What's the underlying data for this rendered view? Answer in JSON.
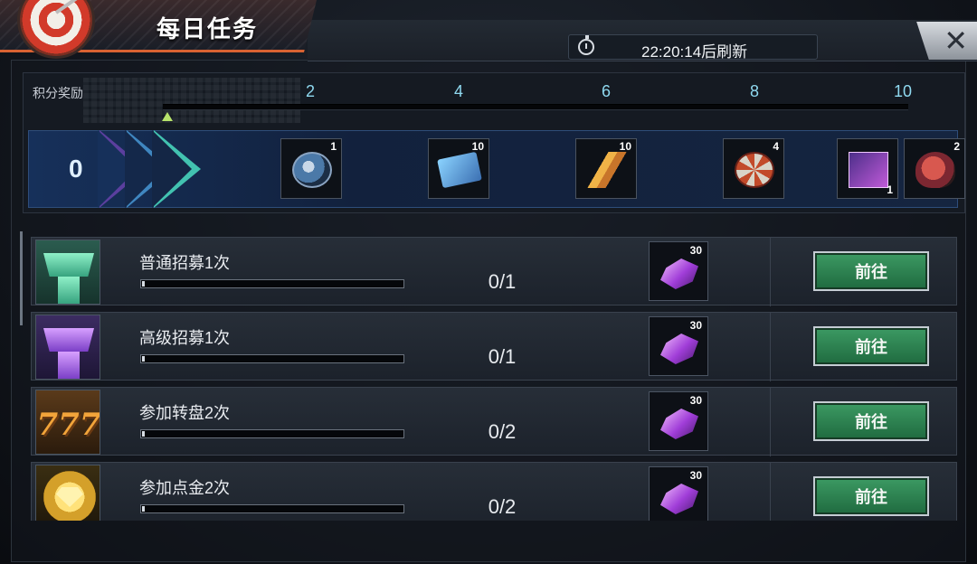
{
  "header": {
    "title": "每日任务",
    "refresh": "22:20:14后刷新",
    "close": "✕"
  },
  "reward": {
    "label": "积分奖励",
    "points": "0",
    "milestones": [
      "2",
      "4",
      "6",
      "8",
      "10"
    ],
    "items": [
      {
        "icon": "coin-icon",
        "count": "1"
      },
      {
        "icon": "ticket-icon",
        "count": "10"
      },
      {
        "icon": "bullet-icon",
        "count": "10"
      },
      {
        "icon": "chip-icon",
        "count": "4"
      },
      {
        "icon": "card-icon",
        "count": "1"
      },
      {
        "icon": "rations-icon",
        "count": "2"
      }
    ]
  },
  "tasks": [
    {
      "name": "普通招募1次",
      "progress": "0/1",
      "fraction": 0,
      "reward": "30",
      "button": "前往",
      "icon": "recruit-green-icon"
    },
    {
      "name": "高级招募1次",
      "progress": "0/1",
      "fraction": 0,
      "reward": "30",
      "button": "前往",
      "icon": "recruit-purple-icon"
    },
    {
      "name": "参加转盘2次",
      "progress": "0/2",
      "fraction": 0,
      "reward": "30",
      "button": "前往",
      "icon": "slot-777-icon"
    },
    {
      "name": "参加点金2次",
      "progress": "0/2",
      "fraction": 0,
      "reward": "30",
      "button": "前往",
      "icon": "gold-coin-icon"
    }
  ]
}
